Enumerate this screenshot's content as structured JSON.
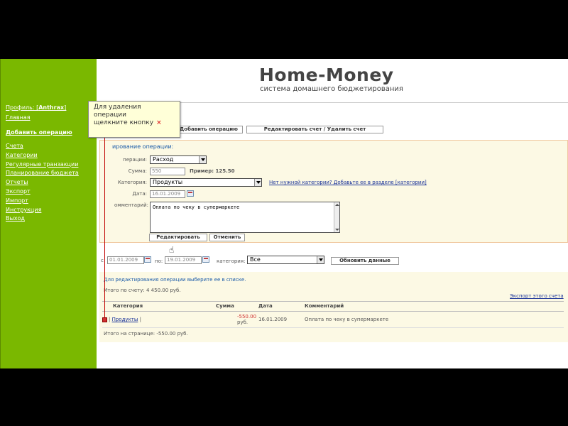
{
  "sidebar": {
    "profile_prefix": "Профиль: [",
    "profile_name": "Anthrax",
    "profile_suffix": "]",
    "home": "Главная",
    "add_operation": "Добавить операцию",
    "menu": [
      "Счета",
      "Категории",
      "Регулярные транзакции",
      "Планирование бюджета",
      "Отчеты",
      "Экспорт",
      "Импорт",
      "Инструкция",
      "Выход"
    ]
  },
  "header": {
    "logo": "Home-Money",
    "tagline": "система домашнего бюджетирования"
  },
  "tooltip": {
    "line1": "Для удаления операции",
    "line2": "щелкните кнопку",
    "close": "×"
  },
  "toolbar": {
    "add_operation": "Добавить операцию",
    "edit_account": "Редактировать счет / Удалить счет"
  },
  "form": {
    "title": "ирование операции:",
    "type_label": "перации:",
    "type_value": "Расход",
    "sum_label": "Сумма:",
    "sum_value": "550",
    "example": "Пример: 125.50",
    "category_label": "Категория:",
    "category_value": "Продукты",
    "no_category_link": "Нет нужной категории? Добавьте ее в разделе [категории]",
    "date_label": "Дата:",
    "date_value": "16.01.2009",
    "comment_label": "омментарий:",
    "comment_value": "Оплата по чеку в супермаркете",
    "edit_button": "Редактировать",
    "cancel_button": "Отменить"
  },
  "filter": {
    "from_label": "с",
    "from_value": "01.01.2009",
    "to_label": "по:",
    "to_value": "19.01.2009",
    "category_label": "категория:",
    "category_value": "Все",
    "update_button": "Обновить данные"
  },
  "list": {
    "hint": "Для редактирования операции выберите ее в списке.",
    "account_total_label": "Итого по счету:",
    "account_total_value": "4 450.00 руб.",
    "export_link": "Экспорт этого счета",
    "columns": [
      "Категория",
      "Сумма",
      "Дата",
      "Комментарий"
    ],
    "rows": [
      {
        "category": "Продукты",
        "amount": "-550.00",
        "currency": "руб.",
        "date": "16.01.2009",
        "comment": "Оплата по чеку в супермаркете"
      }
    ],
    "page_total_label": "Итого на странице:",
    "page_total_value": "-550.00 руб."
  }
}
